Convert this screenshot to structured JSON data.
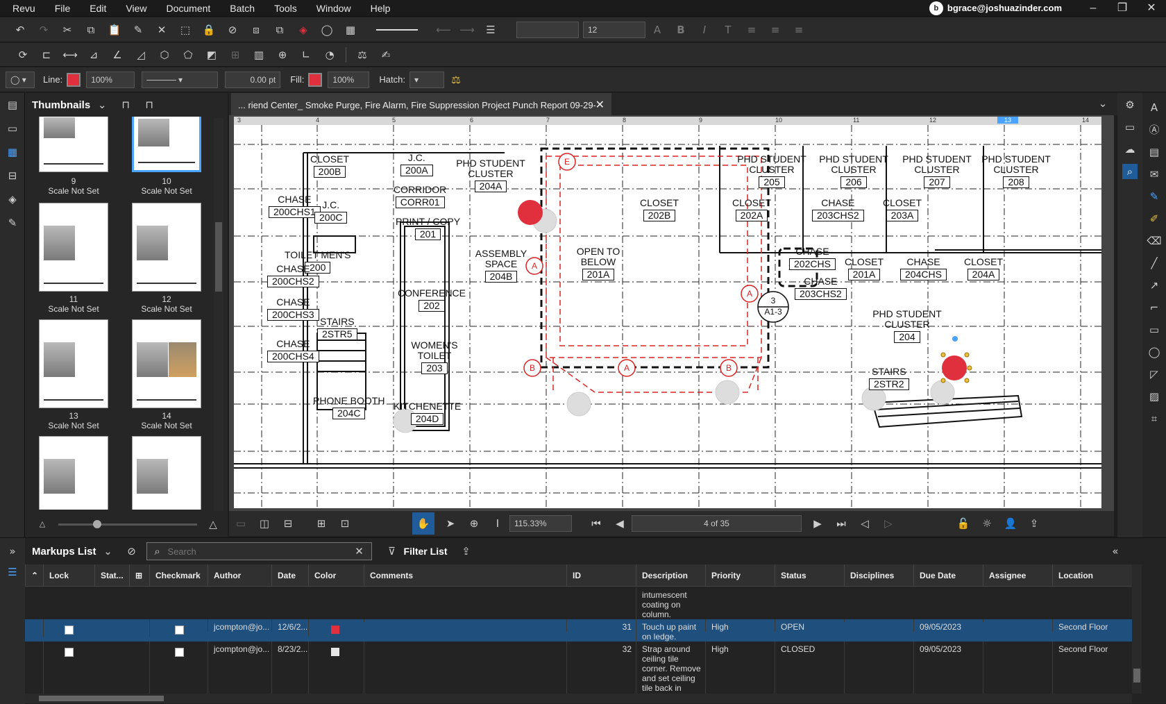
{
  "app": {
    "name": "Revu",
    "user": "bgrace@joshuazinder.com"
  },
  "menu": [
    "Revu",
    "File",
    "Edit",
    "View",
    "Document",
    "Batch",
    "Tools",
    "Window",
    "Help"
  ],
  "props": {
    "line_label": "Line:",
    "line_opacity": "100%",
    "line_width": "0.00 pt",
    "fill_label": "Fill:",
    "fill_opacity": "100%",
    "hatch_label": "Hatch:",
    "font_size": "12",
    "line_color": "#e0303e",
    "fill_color": "#e0303e"
  },
  "thumbs": {
    "title": "Thumbnails",
    "items": [
      {
        "num": "9",
        "scale": "Scale Not Set"
      },
      {
        "num": "10",
        "scale": "Scale Not Set"
      },
      {
        "num": "11",
        "scale": "Scale Not Set"
      },
      {
        "num": "12",
        "scale": "Scale Not Set"
      },
      {
        "num": "13",
        "scale": "Scale Not Set"
      },
      {
        "num": "14",
        "scale": "Scale Not Set"
      }
    ]
  },
  "document": {
    "tab_title": "... riend Center_ Smoke Purge, Fire Alarm, Fire Suppression Project Punch Report 09-29-2023*"
  },
  "ruler": [
    "3",
    "4",
    "5",
    "6",
    "7",
    "8",
    "9",
    "10",
    "11",
    "12",
    "13",
    "14"
  ],
  "drawing": {
    "rooms": [
      {
        "name": "CLOSET",
        "num": "200B"
      },
      {
        "name": "J.C.",
        "num": "200A"
      },
      {
        "name": "PHD STUDENT CLUSTER",
        "num": "204A"
      },
      {
        "name": "CHASE",
        "num": "200CHS1"
      },
      {
        "name": "J.C.",
        "num": "200C"
      },
      {
        "name": "CORRIDOR",
        "num": "CORR01"
      },
      {
        "name": "PRINT / COPY",
        "num": "201"
      },
      {
        "name": "TOILET MEN'S",
        "num": "200"
      },
      {
        "name": "ASSEMBLY SPACE",
        "num": "204B"
      },
      {
        "name": "CHASE",
        "num": "200CHS2"
      },
      {
        "name": "CONFERENCE",
        "num": "202"
      },
      {
        "name": "CHASE",
        "num": "200CHS3"
      },
      {
        "name": "STAIRS",
        "num": "2STR5"
      },
      {
        "name": "CHASE",
        "num": "200CHS4"
      },
      {
        "name": "WOMEN'S TOILET",
        "num": "203"
      },
      {
        "name": "PHONE BOOTH",
        "num": "204C"
      },
      {
        "name": "KITCHENETTE",
        "num": "204D"
      },
      {
        "name": "OPEN TO BELOW",
        "num": "201A"
      },
      {
        "name": "CLOSET",
        "num": "202B"
      },
      {
        "name": "PHD STUDENT CLUSTER",
        "num": "205"
      },
      {
        "name": "PHD STUDENT CLUSTER",
        "num": "206"
      },
      {
        "name": "PHD STUDENT CLUSTER",
        "num": "207"
      },
      {
        "name": "PHD STUDENT CLUSTER",
        "num": "208"
      },
      {
        "name": "CLOSET",
        "num": "202A"
      },
      {
        "name": "CHASE",
        "num": "203CHS2"
      },
      {
        "name": "CLOSET",
        "num": "203A"
      },
      {
        "name": "CHASE",
        "num": "202CHS"
      },
      {
        "name": "CHASE",
        "num": "203CHS2"
      },
      {
        "name": "CLOSET",
        "num": "201A"
      },
      {
        "name": "CHASE",
        "num": "204CHS"
      },
      {
        "name": "CLOSET",
        "num": "204A"
      },
      {
        "name": "PHD STUDENT CLUSTER",
        "num": "204"
      },
      {
        "name": "STAIRS",
        "num": "2STR2"
      }
    ],
    "tags": [
      "E",
      "A",
      "A",
      "B",
      "A",
      "B",
      "202B",
      "3",
      "A1-3"
    ]
  },
  "viewbar": {
    "zoom": "115.33%",
    "page": "4 of 35"
  },
  "markups": {
    "title": "Markups List",
    "search_placeholder": "Search",
    "filter_label": "Filter List",
    "columns": [
      "Lock",
      "Stat...",
      "Checkmark",
      "Author",
      "Date",
      "Color",
      "Comments",
      "ID",
      "Description",
      "Priority",
      "Status",
      "Disciplines",
      "Due Date",
      "Assignee",
      "Location"
    ],
    "rows": [
      {
        "author": "",
        "date": "",
        "color": "",
        "id": "",
        "description": "intumescent coating on column.",
        "priority": "",
        "status": "",
        "due": "",
        "location": ""
      },
      {
        "author": "jcompton@jo...",
        "date": "12/6/2...",
        "color": "#e0303e",
        "id": "31",
        "description": "Touch up paint on ledge.",
        "priority": "High",
        "status": "OPEN",
        "due": "09/05/2023",
        "location": "Second Floor"
      },
      {
        "author": "jcompton@jo...",
        "date": "8/23/2...",
        "color": "#e6e6e6",
        "id": "32",
        "description": "Strap around ceiling tile corner. Remove and set ceiling tile back in place.",
        "priority": "High",
        "status": "CLOSED",
        "due": "09/05/2023",
        "location": "Second Floor"
      }
    ]
  }
}
